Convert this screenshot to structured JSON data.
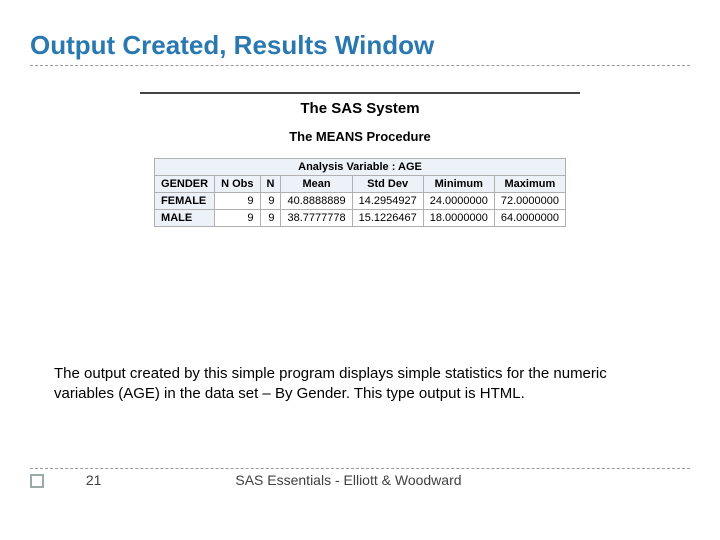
{
  "title": "Output Created, Results Window",
  "sas": {
    "system_title": "The SAS System",
    "proc_title": "The MEANS Procedure",
    "analysis_label": "Analysis Variable : AGE",
    "columns": [
      "GENDER",
      "N Obs",
      "N",
      "Mean",
      "Std Dev",
      "Minimum",
      "Maximum"
    ],
    "rows": [
      {
        "gender": "FEMALE",
        "nobs": "9",
        "n": "9",
        "mean": "40.8888889",
        "std": "14.2954927",
        "min": "24.0000000",
        "max": "72.0000000"
      },
      {
        "gender": "MALE",
        "nobs": "9",
        "n": "9",
        "mean": "38.7777778",
        "std": "15.1226467",
        "min": "18.0000000",
        "max": "64.0000000"
      }
    ]
  },
  "description": "The output created by this simple program displays simple statistics for the numeric variables  (AGE) in the data set – By Gender. This type output is HTML.",
  "footer": {
    "page": "21",
    "text": "SAS Essentials - Elliott & Woodward"
  }
}
